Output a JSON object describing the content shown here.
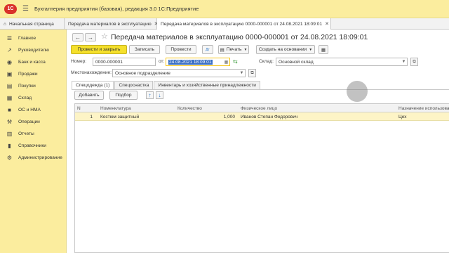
{
  "app": {
    "title": "Бухгалтерия предприятия (базовая), редакция 3.0 1С:Предприятие",
    "logo_text": "1С"
  },
  "tabs": [
    {
      "label": "Начальная страница"
    },
    {
      "label": "Передача материалов в эксплуатацию"
    },
    {
      "label": "Передача материалов в эксплуатацию 0000-000001 от 24.08.2021 18:09:01"
    }
  ],
  "sidebar": {
    "items": [
      {
        "label": "Главное",
        "icon": "list-icon"
      },
      {
        "label": "Руководителю",
        "icon": "chart-icon"
      },
      {
        "label": "Банк и касса",
        "icon": "bank-icon"
      },
      {
        "label": "Продажи",
        "icon": "sales-icon"
      },
      {
        "label": "Покупки",
        "icon": "cart-icon"
      },
      {
        "label": "Склад",
        "icon": "warehouse-icon"
      },
      {
        "label": "ОС и НМА",
        "icon": "assets-icon"
      },
      {
        "label": "Операции",
        "icon": "operations-icon"
      },
      {
        "label": "Отчеты",
        "icon": "reports-icon"
      },
      {
        "label": "Справочники",
        "icon": "book-icon"
      },
      {
        "label": "Администрирование",
        "icon": "gear-icon"
      }
    ]
  },
  "document": {
    "title": "Передача материалов в эксплуатацию 0000-000001 от 24.08.2021 18:09:01"
  },
  "toolbar": {
    "post_close": "Провести и закрыть",
    "save": "Записать",
    "post": "Провести",
    "print": "Печать",
    "create_based": "Создать на основании"
  },
  "form": {
    "number_label": "Номер:",
    "number_value": "0000-000001",
    "date_label": "от:",
    "date_value": "24.08.2021 18:09:01",
    "warehouse_label": "Склад:",
    "warehouse_value": "Основной склад",
    "location_label": "Местонахождение:",
    "location_value": "Основное подразделение"
  },
  "form_tabs": [
    {
      "label": "Спецодежда (1)"
    },
    {
      "label": "Спецоснастка"
    },
    {
      "label": "Инвентарь и хозяйственные принадлежности"
    }
  ],
  "table_toolbar": {
    "add": "Добавить",
    "select": "Подбор"
  },
  "table": {
    "columns": [
      "N",
      "Номенклатура",
      "Количество",
      "Физическое лицо",
      "Назначение использования"
    ],
    "rows": [
      {
        "n": "1",
        "item": "Костюм защитный",
        "qty": "1,000",
        "person": "Иванов Степан Федорович",
        "purpose": "Цех"
      }
    ]
  }
}
